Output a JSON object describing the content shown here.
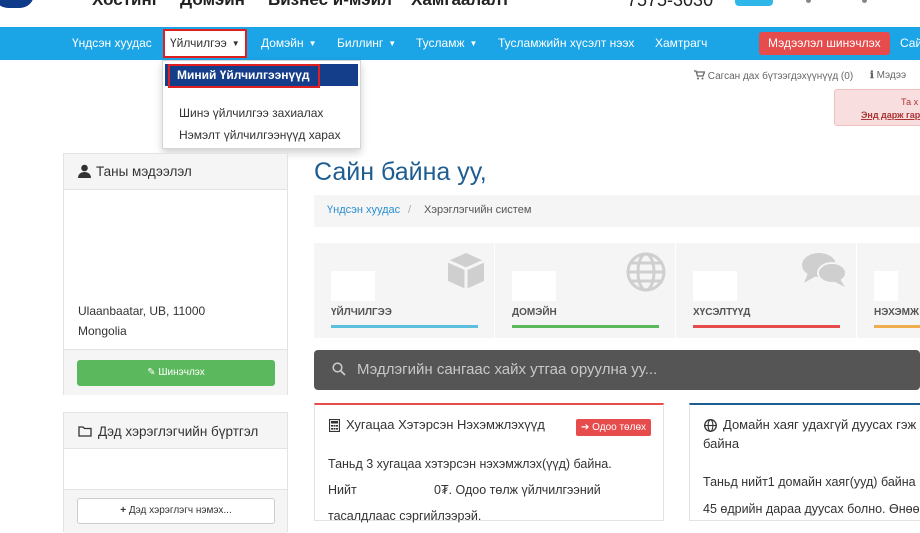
{
  "topbar": {
    "cut_items": [
      "Хостинг",
      "Домэйн",
      "Бизнес и-мэйл",
      "Хамгаалалт"
    ],
    "phone": "7575-3030"
  },
  "nav": {
    "items": [
      {
        "label": "Үндсэн хуудас",
        "caret": false
      },
      {
        "label": "Үйлчилгээ",
        "caret": true,
        "active": true
      },
      {
        "label": "Домэйн",
        "caret": true
      },
      {
        "label": "Биллинг",
        "caret": true
      },
      {
        "label": "Тусламж",
        "caret": true
      },
      {
        "label": "Тусламжийн хүсэлт нээх",
        "caret": false
      },
      {
        "label": "Хамтрагч",
        "caret": false
      }
    ],
    "update_button": "Мэдээлэл шинэчлэх",
    "cut_right": "Сай"
  },
  "dropdown": {
    "items": [
      "Миний Үйлчилгээнүүд",
      "Шинэ үйлчилгээ захиалах",
      "Нэмэлт үйлчилгээнүүд харах"
    ]
  },
  "cart": {
    "label": "Сагсан дах бүтээгдэхүүнүүд (0)"
  },
  "info": {
    "label": "Мэдээ"
  },
  "alert": {
    "line1": "Та х",
    "line2": "Энд дарж гар"
  },
  "profile": {
    "title": "Таны мэдээлэл",
    "address_line1": "Ulaanbaatar, UB, 11000",
    "address_line2": "Mongolia",
    "edit_button": "Шинэчлэх"
  },
  "contacts": {
    "title": "Дэд хэрэглэгчийн бүртгэл",
    "add_button": "Дэд хэрэглэгч нэмэх..."
  },
  "welcome": "Сайн байна уу,",
  "breadcrumb": {
    "home": "Үндсэн хуудас",
    "current": "Хэрэглэгчийн систем"
  },
  "tiles": [
    {
      "label": "ҮЙЛЧИЛГЭЭ",
      "color": "#5bc0de",
      "icon": "cube-icon"
    },
    {
      "label": "ДОМЭЙН",
      "color": "#5cb85c",
      "icon": "globe-icon"
    },
    {
      "label": "ХҮСЭЛТҮҮД",
      "color": "#e64c4c",
      "icon": "comments-icon"
    },
    {
      "label": "НЭХЭМЖ",
      "color": "#f0ad4e",
      "icon": ""
    }
  ],
  "search": {
    "placeholder": "Мэдлэгийн сангаас хайх утгаа оруулна уу..."
  },
  "invoices_card": {
    "title": "Хугацаа Хэтэрсэн Нэхэмжлэхүүд",
    "pay_button": "Одоо төлөх",
    "line1": "Таньд 3 хугацаа хэтэрсэн нэхэмжлэх(үүд) байна.",
    "line2_a": "Нийт",
    "line2_b": "0₮. Одоо төлж үйлчилгээний",
    "line3": "тасалдлаас сэргийлээрэй."
  },
  "domains_card": {
    "title_1": "Домайн хаяг удахгүй дуусах гэж",
    "title_2": "байна",
    "line1": "Таньд нийт1 домайн хаяг(ууд) байна",
    "line2": "45 өдрийн дараа дуусах болно. Өнөө"
  }
}
